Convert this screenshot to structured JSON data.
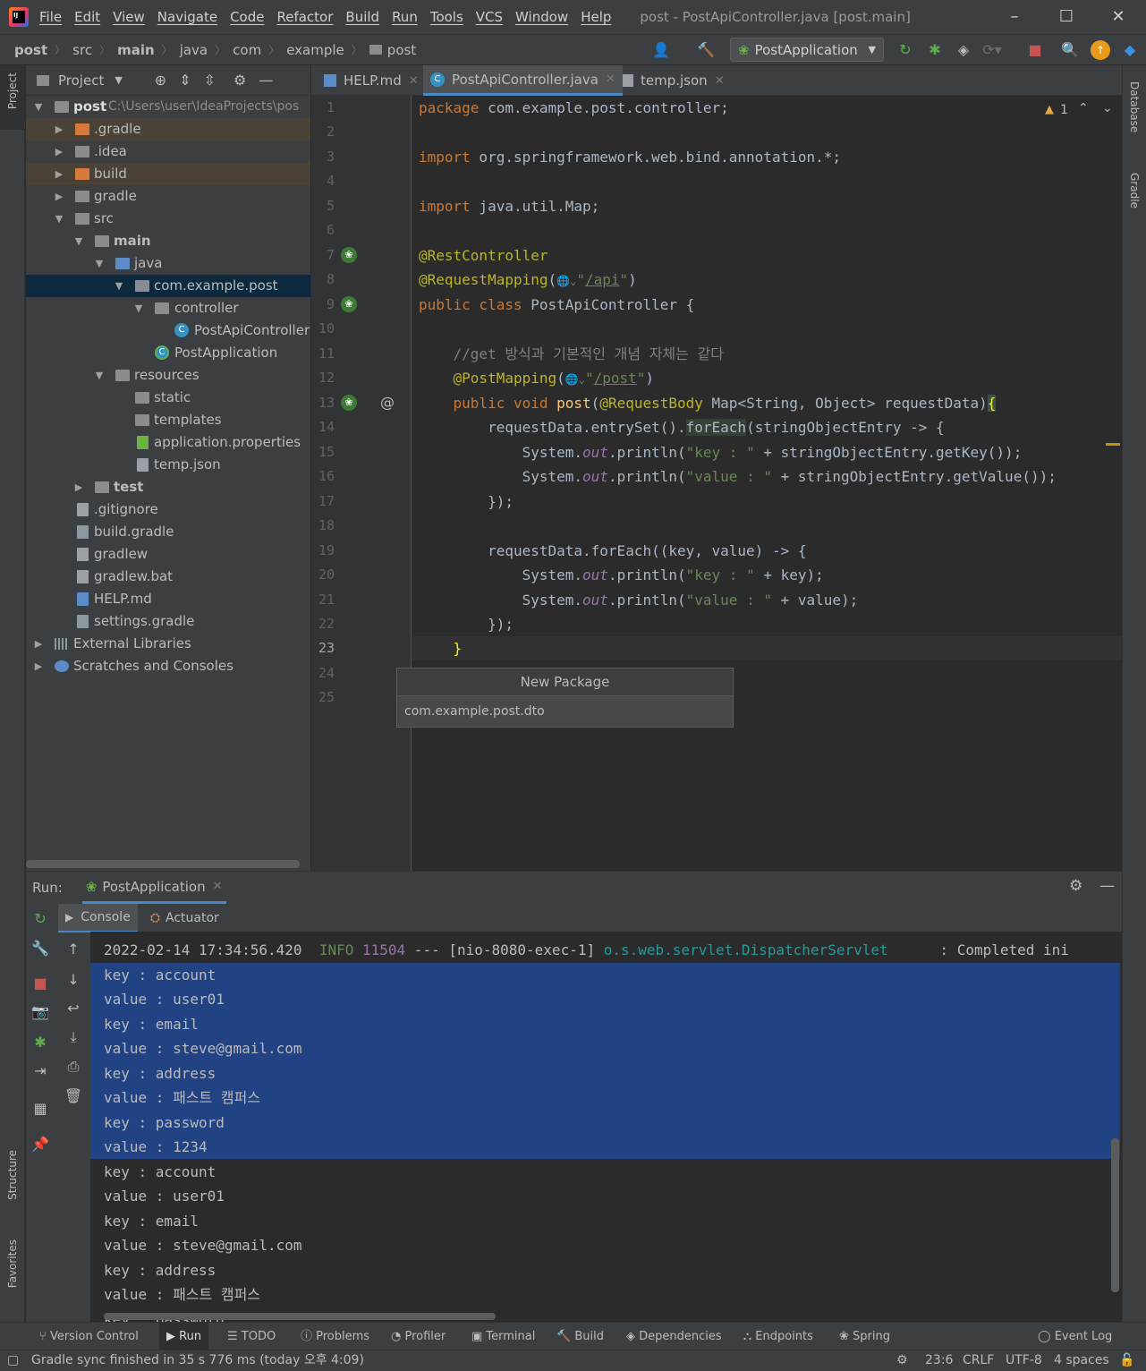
{
  "window": {
    "menu": [
      "File",
      "Edit",
      "View",
      "Navigate",
      "Code",
      "Refactor",
      "Build",
      "Run",
      "Tools",
      "VCS",
      "Window",
      "Help"
    ],
    "title": "post - PostApiController.java [post.main]",
    "controls": {
      "minimize": "–",
      "maximize": "☐",
      "close": "✕"
    }
  },
  "breadcrumb": [
    "post",
    "src",
    "main",
    "java",
    "com",
    "example",
    "post"
  ],
  "toolbar": {
    "run_config": "PostApplication"
  },
  "left_stripe": {
    "project_tab": "Project",
    "structure_tab": "Structure",
    "favorites_tab": "Favorites"
  },
  "right_stripe": {
    "database_tab": "Database",
    "gradle_tab": "Gradle"
  },
  "project": {
    "header": "Project",
    "root_label": "post",
    "root_path": "C:\\Users\\user\\IdeaProjects\\pos",
    "items": [
      {
        "label": ".gradle",
        "kind": "folder-orange"
      },
      {
        "label": ".idea",
        "kind": "folder"
      },
      {
        "label": "build",
        "kind": "folder-orange"
      },
      {
        "label": "gradle",
        "kind": "folder"
      },
      {
        "label": "src",
        "kind": "folder"
      },
      {
        "label": "main",
        "kind": "folder"
      },
      {
        "label": "java",
        "kind": "folder-blue"
      },
      {
        "label": "com.example.post",
        "kind": "package"
      },
      {
        "label": "controller",
        "kind": "package"
      },
      {
        "label": "PostApiController",
        "kind": "class"
      },
      {
        "label": "PostApplication",
        "kind": "class"
      },
      {
        "label": "resources",
        "kind": "folder"
      },
      {
        "label": "static",
        "kind": "folder"
      },
      {
        "label": "templates",
        "kind": "folder"
      },
      {
        "label": "application.properties",
        "kind": "file"
      },
      {
        "label": "temp.json",
        "kind": "file"
      },
      {
        "label": "test",
        "kind": "folder"
      },
      {
        "label": ".gitignore",
        "kind": "file"
      },
      {
        "label": "build.gradle",
        "kind": "file"
      },
      {
        "label": "gradlew",
        "kind": "file"
      },
      {
        "label": "gradlew.bat",
        "kind": "file"
      },
      {
        "label": "HELP.md",
        "kind": "file"
      },
      {
        "label": "settings.gradle",
        "kind": "file"
      },
      {
        "label": "External Libraries",
        "kind": "lib"
      },
      {
        "label": "Scratches and Consoles",
        "kind": "scratch"
      }
    ]
  },
  "editor": {
    "tabs": [
      "HELP.md",
      "PostApiController.java",
      "temp.json"
    ],
    "warnings": "1",
    "line_numbers": [
      "1",
      "2",
      "3",
      "4",
      "5",
      "6",
      "7",
      "8",
      "9",
      "10",
      "11",
      "12",
      "13",
      "14",
      "15",
      "16",
      "17",
      "18",
      "19",
      "20",
      "21",
      "22",
      "23",
      "24",
      "25"
    ],
    "lines": {
      "l1a": "package",
      "l1b": " com.example.post.controller;",
      "l3a": "import",
      "l3b": " org.springframework.web.bind.annotation.*;",
      "l5a": "import",
      "l5b": " java.util.Map;",
      "l7": "@RestController",
      "l8a": "@RequestMapping",
      "l8b": "(",
      "l8c": "🌐⌄",
      "l8d": "\"",
      "l8e": "/api",
      "l8f": "\"",
      "l8g": ")",
      "l9a": "public class",
      "l9b": " PostApiController {",
      "l11": "    //get 방식과 기본적인 개념 자체는 같다",
      "l12a": "    @PostMapping",
      "l12b": "(",
      "l12c": "🌐⌄",
      "l12d": "\"",
      "l12e": "/post",
      "l12f": "\"",
      "l12g": ")",
      "l13a": "    public void",
      "l13b": " post",
      "l13c": "(",
      "l13d": "@RequestBody",
      "l13e": " Map<String, Object> requestData)",
      "l13f": "{",
      "l14a": "        requestData.entrySet().",
      "l14b": "forEach",
      "l14c": "(stringObjectEntry -> {",
      "l15a": "            System.",
      "l15b": "out",
      "l15c": ".println(",
      "l15d": "\"key : \"",
      "l15e": " + stringObjectEntry.getKey());",
      "l16a": "            System.",
      "l16b": "out",
      "l16c": ".println(",
      "l16d": "\"value : \"",
      "l16e": " + stringObjectEntry.getValue());",
      "l17": "        });",
      "l19": "        requestData.forEach((key, value) -> {",
      "l20a": "            System.",
      "l20b": "out",
      "l20c": ".println(",
      "l20d": "\"key : \"",
      "l20e": " + key);",
      "l21a": "            System.",
      "l21b": "out",
      "l21c": ".println(",
      "l21d": "\"value : \"",
      "l21e": " + value);",
      "l22": "        });",
      "l23": "    }"
    }
  },
  "new_package": {
    "title": "New Package",
    "value": "com.example.post.dto"
  },
  "run": {
    "label": "Run:",
    "tab": "PostApplication",
    "console_tab": "Console",
    "actuator_tab": "Actuator",
    "log_line": {
      "ts": "2022-02-14 17:34:56.420",
      "level": "INFO",
      "pid": "11504",
      "sep": " --- [nio-8080-exec-1] ",
      "logger": "o.s.web.servlet.DispatcherServlet",
      "msg": "      : Completed ini"
    },
    "output": [
      "key : account",
      "value : user01",
      "key : email",
      "value : steve@gmail.com",
      "key : address",
      "value : 패스트 캠퍼스",
      "key : password",
      "value : 1234",
      "key : account",
      "value : user01",
      "key : email",
      "value : steve@gmail.com",
      "key : address",
      "value : 패스트 캠퍼스",
      "key : password"
    ]
  },
  "tool_windows": [
    "Version Control",
    "Run",
    "TODO",
    "Problems",
    "Profiler",
    "Terminal",
    "Build",
    "Dependencies",
    "Endpoints",
    "Spring",
    "Event Log"
  ],
  "status": {
    "message": "Gradle sync finished in 35 s 776 ms (today 오후 4:09)",
    "position": "23:6",
    "line_sep": "CRLF",
    "encoding": "UTF-8",
    "indent": "4 spaces"
  },
  "colors": {
    "accent": "#4a88c7",
    "selection": "#214283",
    "keyword": "#cc7832",
    "annotation": "#bbb529",
    "string": "#6a8759"
  }
}
